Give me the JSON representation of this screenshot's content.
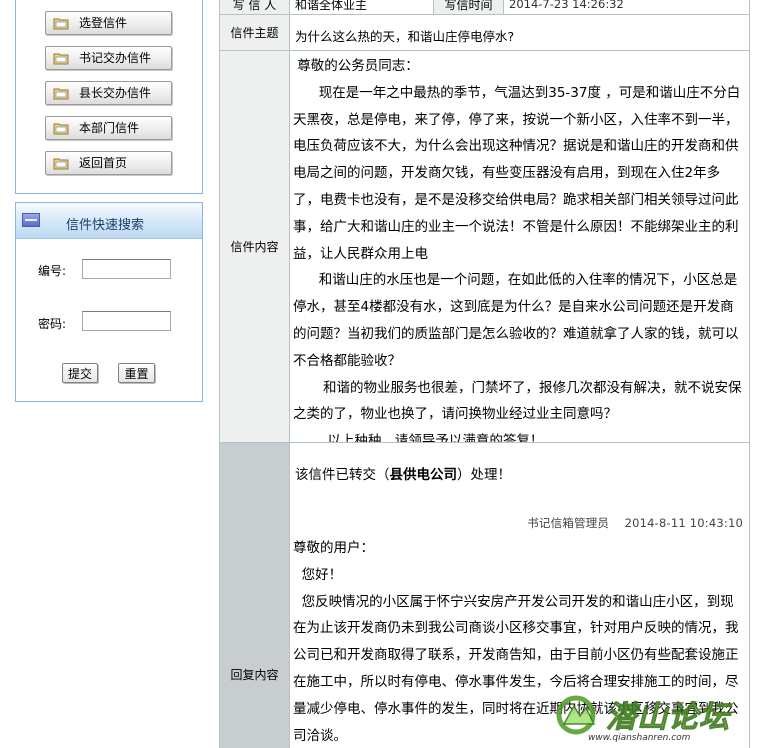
{
  "sidebar": {
    "nav_items": [
      {
        "label": "选登信件",
        "icon": "folder-icon"
      },
      {
        "label": "书记交办信件",
        "icon": "folder-icon"
      },
      {
        "label": "县长交办信件",
        "icon": "folder-icon"
      },
      {
        "label": "本部门信件",
        "icon": "folder-icon"
      },
      {
        "label": "返回首页",
        "icon": "folder-icon"
      }
    ],
    "search": {
      "title": "信件快速搜索",
      "number_label": "编号:",
      "number_value": "",
      "password_label": "密码:",
      "password_value": "",
      "submit_label": "提交",
      "reset_label": "重置"
    }
  },
  "letter": {
    "writer_label": "写 信 人",
    "writer_value": "和谐全体业主",
    "time_label": "写信时间",
    "time_value": "2014-7-23 14:26:32",
    "subject_label": "信件主题",
    "subject_value": "为什么这么热的天，和谐山庄停电停水?",
    "content_label": "信件内容",
    "content_paragraphs": [
      " 尊敬的公务员同志：",
      "      现在是一年之中最热的季节，气温达到35-37度 ，可是和谐山庄不分白天黑夜，总是停电，来了停，停了来，按说一个新小区，入住率不到一半，电压负荷应该不大，为什么会出现这种情况？据说是和谐山庄的开发商和供电局之间的问题，开发商欠钱，有些变压器没有启用，到现在入住2年多了，电费卡也没有，是不是没移交给供电局？跪求相关部门相关领导过问此事，给广大和谐山庄的业主一个说法！不管是什么原因！不能绑架业主的利益，让人民群众用上电",
      "      和谐山庄的水压也是一个问题，在如此低的入住率的情况下，小区总是停水，甚至4楼都没有水，这到底是为什么？是自来水公司问题还是开发商的问题？当初我们的质监部门是怎么验收的？难道就拿了人家的钱，就可以不合格都能验收？",
      "       和谐的物业服务也很差，门禁坏了，报修几次都没有解决，就不说安保之类的了，物业也换了，请问换物业经过业主同意吗？",
      "        以上种种，请领导予以满意的答复！"
    ],
    "reply_label": "回复内容",
    "transfer_prefix": "该信件已转交（",
    "transfer_org": "县供电公司",
    "transfer_suffix": "）处理！",
    "reply_author": "书记信箱管理员",
    "reply_time": "2014-8-11 10:43:10",
    "reply_paragraphs": [
      "尊敬的用户：",
      "  您好！",
      "  您反映情况的小区属于怀宁兴安房产开发公司开发的和谐山庄小区，到现在为止该开发商仍未到我公司商谈小区移交事宜，针对用户反映的情况，我公司已和开发商取得了联系，开发商告知，由于目前小区仍有些配套设施正在施工中，所以时有停电、停水事件发生，今后将合理安排施工的时间，尽量减少停电、停水事件的发生，同时将在近期内协就该小区移交事宜到我公司洽谈。"
    ]
  },
  "watermark": {
    "logo_text": "潜山论坛",
    "url": "www.qianshanren.com"
  },
  "colors": {
    "border": "#b4c2cc",
    "label_bg": "#eef0f0",
    "reply_label_bg": "#c8cdd0",
    "panel_border": "#8cb6dc"
  }
}
